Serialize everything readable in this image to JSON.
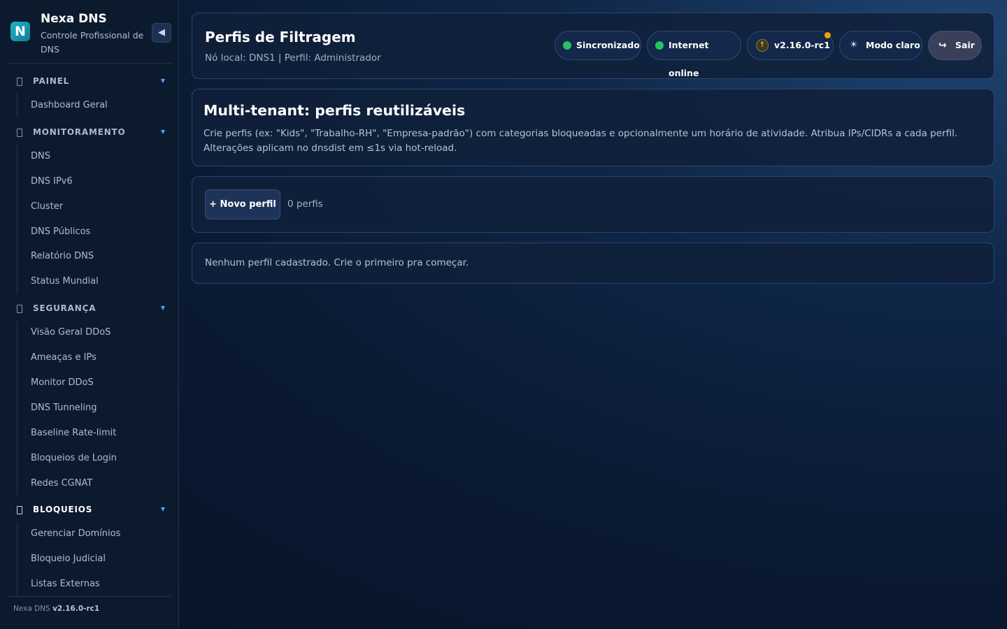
{
  "sidebar": {
    "brand": {
      "logo_letter": "N",
      "name": "Nexa DNS",
      "subtitle": "Controle Profissional de DNS"
    },
    "collapse_icon": "◀",
    "sections": [
      {
        "label": "PAINEL",
        "items": [
          "Dashboard Geral"
        ]
      },
      {
        "label": "MONITORAMENTO",
        "items": [
          "DNS",
          "DNS IPv6",
          "Cluster",
          "DNS Públicos",
          "Relatório DNS",
          "Status Mundial"
        ]
      },
      {
        "label": "SEGURANÇA",
        "items": [
          "Visão Geral DDoS",
          "Ameaças e IPs",
          "Monitor DDoS",
          "DNS Tunneling",
          "Baseline Rate-limit",
          "Bloqueios de Login",
          "Redes CGNAT"
        ]
      },
      {
        "label": "BLOQUEIOS",
        "items": [
          "Gerenciar Domínios",
          "Bloqueio Judicial",
          "Listas Externas"
        ]
      }
    ],
    "footer": {
      "app": "Nexa DNS",
      "version": "v2.16.0-rc1"
    }
  },
  "header": {
    "title": "Perfis de Filtragem",
    "subtitle": "Nó local: DNS1 | Perfil: Administrador",
    "status": [
      {
        "label": "Sincronizado",
        "color": "#22c55e"
      },
      {
        "label": "Internet online",
        "color": "#22c55e"
      }
    ],
    "version": {
      "label": "v2.16.0-rc1",
      "icon": "↑",
      "update_dot_color": "#f59e0b"
    },
    "theme_toggle": {
      "icon": "☀",
      "label": "Modo claro"
    },
    "logout": {
      "icon": "↪",
      "label": "Sair"
    }
  },
  "info": {
    "title": "Multi-tenant: perfis reutilizáveis",
    "body": "Crie perfis (ex: \"Kids\", \"Trabalho-RH\", \"Empresa-padrão\") com categorias bloqueadas e opcionalmente um horário de atividade. Atribua IPs/CIDRs a cada perfil. Alterações aplicam no dnsdist em ≤1s via hot-reload."
  },
  "actions": {
    "new_profile_label": "+ Novo perfil",
    "count_label": "0 perfis"
  },
  "empty_state": {
    "message": "Nenhum perfil cadastrado. Crie o primeiro pra começar."
  }
}
